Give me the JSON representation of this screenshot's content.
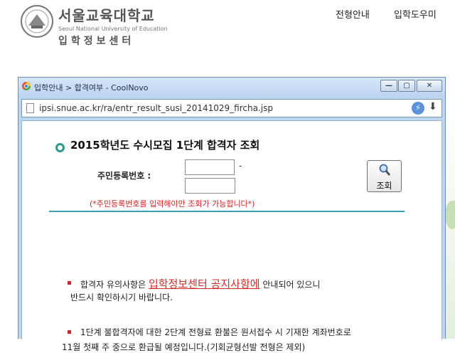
{
  "site": {
    "logo_ko": "서울교육대학교",
    "logo_en": "Seoul National University of Education",
    "logo_sub": "입학정보센터",
    "nav": [
      "전형안내",
      "입학도우미"
    ]
  },
  "window": {
    "title": "입학안내 > 합격여부 - CoolNovo",
    "url": "ipsi.snue.ac.kr/ra/entr_result_susi_20141029_fircha.jsp",
    "buttons": {
      "minimize": "—",
      "maximize": "▢",
      "close": "✕"
    }
  },
  "form": {
    "heading": "2015학년도 수시모집 1단계 합격자 조회",
    "ssn_label": "주민등록번호 :",
    "ssn_first_value": "",
    "ssn_second_value": "",
    "dash": "-",
    "lookup_label": "조회",
    "notice": "(*주민등록번호를 입력해야만 조회가 가능합니다*)"
  },
  "notes": {
    "n1_prefix": "합격자 유의사항은",
    "n1_link": "입학정보센터 공지사항에",
    "n1_suffix": "안내되어 있으니",
    "n1_line2": "반드시 확인하시기 바랍니다.",
    "n2_line1": "1단계 불합격자에 대한 2단계 전형료 환불은 원서접수 시 기재한 계좌번호로",
    "n2_line2": "11월 첫째 주 중으로 환급될 예정입니다.(기회균형선발 전형은 제외)"
  },
  "colors": {
    "accent_teal": "#2f9a8a",
    "divider": "#3aa3b0",
    "notice_red": "#d01e1e",
    "titlebar": "#bcd5ef"
  },
  "icons": [
    "university-seal-icon",
    "coolnovo-icon",
    "page-icon",
    "bolt-icon",
    "download-icon",
    "magnifier-icon"
  ]
}
